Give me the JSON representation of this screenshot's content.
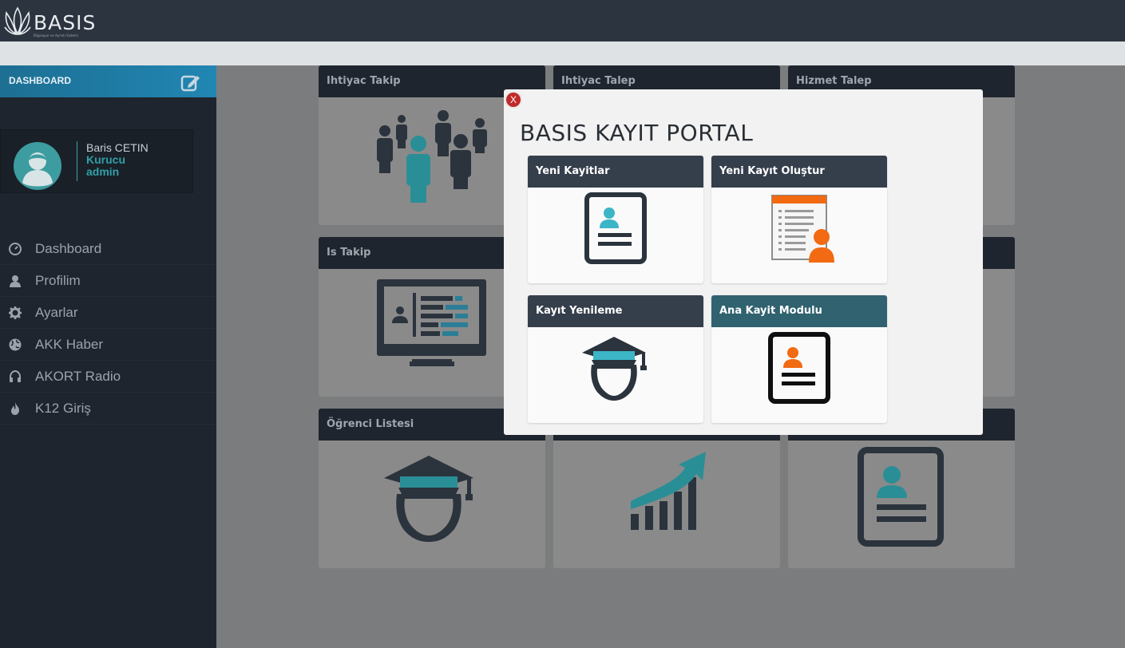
{
  "app": {
    "logo_text": "BASIS",
    "logo_subtitle": "Bilgisayar ve Ayrıntı Sistemi"
  },
  "sidebar": {
    "header_title": "DASHBOARD",
    "user": {
      "name": "Baris CETIN",
      "role": "Kurucu",
      "permission": "admin"
    },
    "items": [
      {
        "label": "Dashboard",
        "icon": "dashboard-icon"
      },
      {
        "label": "Profilim",
        "icon": "user-icon"
      },
      {
        "label": "Ayarlar",
        "icon": "gear-icon"
      },
      {
        "label": "AKK Haber",
        "icon": "globe-icon"
      },
      {
        "label": "AKORT Radio",
        "icon": "headphones-icon"
      },
      {
        "label": "K12 Giriş",
        "icon": "fire-icon"
      }
    ]
  },
  "dashboard": {
    "cards": [
      {
        "title": "Ihtiyac Takip",
        "icon": "people-icon"
      },
      {
        "title": "Ihtiyac Talep",
        "icon": ""
      },
      {
        "title": "Hizmet Talep",
        "icon": ""
      },
      {
        "title": "Is Takip",
        "icon": "monitor-icon"
      },
      {
        "title": "Öğrenci Listesi",
        "icon": "graduate-icon"
      },
      {
        "title": "",
        "icon": "growth-chart-icon"
      },
      {
        "title": "",
        "icon": "id-card-icon"
      }
    ]
  },
  "modal": {
    "close_label": "X",
    "title": "BASIS KAYIT PORTAL",
    "cards": [
      {
        "title": "Yeni Kayitlar",
        "icon": "id-card-icon",
        "header_color": "#353e4b"
      },
      {
        "title": "Yeni Kayıt Oluştur",
        "icon": "form-user-icon",
        "header_color": "#353e4b"
      },
      {
        "title": "Kayıt Yenileme",
        "icon": "graduate-icon",
        "header_color": "#353e4b"
      },
      {
        "title": "Ana Kayit Modulu",
        "icon": "id-card-orange-icon",
        "header_color": "#30626f"
      }
    ]
  },
  "colors": {
    "topbar": "#2c3440",
    "sidebar": "#1e252e",
    "accent_teal": "#2a8e96",
    "accent_orange": "#f26a12",
    "icon_dark": "#2b333d"
  }
}
